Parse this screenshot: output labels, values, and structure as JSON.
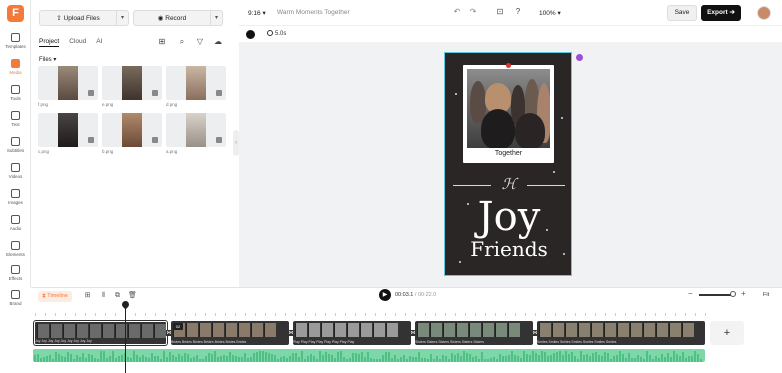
{
  "app": {
    "logo_letter": "F",
    "accent_color": "#f47a3b"
  },
  "rail": {
    "items": [
      {
        "label": "Templates",
        "icon": "templates-icon"
      },
      {
        "label": "Media",
        "icon": "media-icon",
        "active": true
      },
      {
        "label": "Tools",
        "icon": "tools-icon"
      },
      {
        "label": "Text",
        "icon": "text-icon"
      },
      {
        "label": "Subtitles",
        "icon": "subtitles-icon"
      },
      {
        "label": "Videos",
        "icon": "videos-icon"
      },
      {
        "label": "Images",
        "icon": "images-icon"
      },
      {
        "label": "Audio",
        "icon": "audio-icon"
      },
      {
        "label": "Elements",
        "icon": "elements-icon"
      },
      {
        "label": "Effects",
        "icon": "effects-icon"
      },
      {
        "label": "Brand",
        "icon": "brand-icon"
      }
    ]
  },
  "panel": {
    "upload_label": "Upload Files",
    "record_label": "Record",
    "tabs": [
      {
        "label": "Project",
        "active": true
      },
      {
        "label": "Cloud"
      },
      {
        "label": "AI"
      }
    ],
    "files_label": "Files",
    "files": [
      {
        "name": "f.png"
      },
      {
        "name": "e.png"
      },
      {
        "name": "d.png"
      },
      {
        "name": "c.png"
      },
      {
        "name": "b.png"
      },
      {
        "name": "a.png"
      }
    ]
  },
  "topbar": {
    "aspect": "9:16",
    "project_title": "Warm Moments Together",
    "zoom": "100%",
    "save_label": "Save",
    "export_label": "Export"
  },
  "subbar": {
    "duration": "5.0s"
  },
  "canvas": {
    "polaroid_caption": "Together",
    "monogram": "ℋ",
    "headline": "Joy",
    "subheadline": "Friends",
    "card_bg": "#2a2626",
    "selection_color": "#5ec9dc"
  },
  "timeline": {
    "tab_label": "Timeline",
    "current_time": "00:03.1",
    "total_time": "/ 00:22.0",
    "fit_label": "Fit",
    "clips": [
      {
        "num": "",
        "caption": "Joy  Joy  Joy  Joy  Joy  Joy  Joy  Joy  Joy"
      },
      {
        "num": "02",
        "caption": "Brides  Brides  Brides  Brides  Brides  Brides  Brides"
      },
      {
        "num": "",
        "caption": "Play  Play  Play  Play  Play  Play  Play  Play"
      },
      {
        "num": "",
        "caption": "Sisters  Sisters  Sisters  Sisters  Sisters  Sisters"
      },
      {
        "num": "",
        "caption": "Smiles  Smiles  Smiles  Smiles  Smiles  Smiles  Smiles"
      }
    ],
    "add_label": "+",
    "audio_color": "#7ed7a8"
  }
}
